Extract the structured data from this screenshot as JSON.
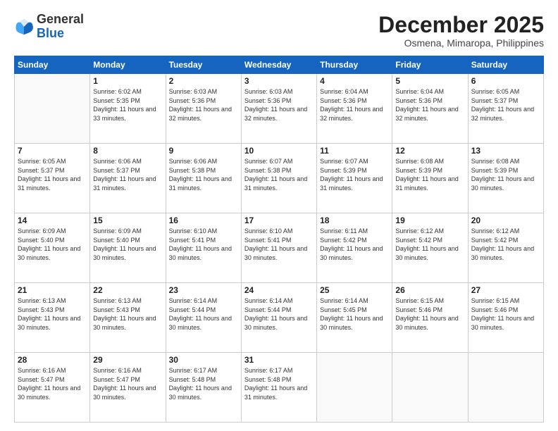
{
  "header": {
    "logo_general": "General",
    "logo_blue": "Blue",
    "title": "December 2025",
    "subtitle": "Osmena, Mimaropa, Philippines"
  },
  "calendar": {
    "days_of_week": [
      "Sunday",
      "Monday",
      "Tuesday",
      "Wednesday",
      "Thursday",
      "Friday",
      "Saturday"
    ],
    "weeks": [
      [
        {
          "day": "",
          "empty": true
        },
        {
          "day": "1",
          "sunrise": "6:02 AM",
          "sunset": "5:35 PM",
          "daylight": "11 hours and 33 minutes."
        },
        {
          "day": "2",
          "sunrise": "6:03 AM",
          "sunset": "5:36 PM",
          "daylight": "11 hours and 32 minutes."
        },
        {
          "day": "3",
          "sunrise": "6:03 AM",
          "sunset": "5:36 PM",
          "daylight": "11 hours and 32 minutes."
        },
        {
          "day": "4",
          "sunrise": "6:04 AM",
          "sunset": "5:36 PM",
          "daylight": "11 hours and 32 minutes."
        },
        {
          "day": "5",
          "sunrise": "6:04 AM",
          "sunset": "5:36 PM",
          "daylight": "11 hours and 32 minutes."
        },
        {
          "day": "6",
          "sunrise": "6:05 AM",
          "sunset": "5:37 PM",
          "daylight": "11 hours and 32 minutes."
        }
      ],
      [
        {
          "day": "7",
          "sunrise": "6:05 AM",
          "sunset": "5:37 PM",
          "daylight": "11 hours and 31 minutes."
        },
        {
          "day": "8",
          "sunrise": "6:06 AM",
          "sunset": "5:37 PM",
          "daylight": "11 hours and 31 minutes."
        },
        {
          "day": "9",
          "sunrise": "6:06 AM",
          "sunset": "5:38 PM",
          "daylight": "11 hours and 31 minutes."
        },
        {
          "day": "10",
          "sunrise": "6:07 AM",
          "sunset": "5:38 PM",
          "daylight": "11 hours and 31 minutes."
        },
        {
          "day": "11",
          "sunrise": "6:07 AM",
          "sunset": "5:39 PM",
          "daylight": "11 hours and 31 minutes."
        },
        {
          "day": "12",
          "sunrise": "6:08 AM",
          "sunset": "5:39 PM",
          "daylight": "11 hours and 31 minutes."
        },
        {
          "day": "13",
          "sunrise": "6:08 AM",
          "sunset": "5:39 PM",
          "daylight": "11 hours and 30 minutes."
        }
      ],
      [
        {
          "day": "14",
          "sunrise": "6:09 AM",
          "sunset": "5:40 PM",
          "daylight": "11 hours and 30 minutes."
        },
        {
          "day": "15",
          "sunrise": "6:09 AM",
          "sunset": "5:40 PM",
          "daylight": "11 hours and 30 minutes."
        },
        {
          "day": "16",
          "sunrise": "6:10 AM",
          "sunset": "5:41 PM",
          "daylight": "11 hours and 30 minutes."
        },
        {
          "day": "17",
          "sunrise": "6:10 AM",
          "sunset": "5:41 PM",
          "daylight": "11 hours and 30 minutes."
        },
        {
          "day": "18",
          "sunrise": "6:11 AM",
          "sunset": "5:42 PM",
          "daylight": "11 hours and 30 minutes."
        },
        {
          "day": "19",
          "sunrise": "6:12 AM",
          "sunset": "5:42 PM",
          "daylight": "11 hours and 30 minutes."
        },
        {
          "day": "20",
          "sunrise": "6:12 AM",
          "sunset": "5:42 PM",
          "daylight": "11 hours and 30 minutes."
        }
      ],
      [
        {
          "day": "21",
          "sunrise": "6:13 AM",
          "sunset": "5:43 PM",
          "daylight": "11 hours and 30 minutes."
        },
        {
          "day": "22",
          "sunrise": "6:13 AM",
          "sunset": "5:43 PM",
          "daylight": "11 hours and 30 minutes."
        },
        {
          "day": "23",
          "sunrise": "6:14 AM",
          "sunset": "5:44 PM",
          "daylight": "11 hours and 30 minutes."
        },
        {
          "day": "24",
          "sunrise": "6:14 AM",
          "sunset": "5:44 PM",
          "daylight": "11 hours and 30 minutes."
        },
        {
          "day": "25",
          "sunrise": "6:14 AM",
          "sunset": "5:45 PM",
          "daylight": "11 hours and 30 minutes."
        },
        {
          "day": "26",
          "sunrise": "6:15 AM",
          "sunset": "5:46 PM",
          "daylight": "11 hours and 30 minutes."
        },
        {
          "day": "27",
          "sunrise": "6:15 AM",
          "sunset": "5:46 PM",
          "daylight": "11 hours and 30 minutes."
        }
      ],
      [
        {
          "day": "28",
          "sunrise": "6:16 AM",
          "sunset": "5:47 PM",
          "daylight": "11 hours and 30 minutes."
        },
        {
          "day": "29",
          "sunrise": "6:16 AM",
          "sunset": "5:47 PM",
          "daylight": "11 hours and 30 minutes."
        },
        {
          "day": "30",
          "sunrise": "6:17 AM",
          "sunset": "5:48 PM",
          "daylight": "11 hours and 30 minutes."
        },
        {
          "day": "31",
          "sunrise": "6:17 AM",
          "sunset": "5:48 PM",
          "daylight": "11 hours and 31 minutes."
        },
        {
          "day": "",
          "empty": true
        },
        {
          "day": "",
          "empty": true
        },
        {
          "day": "",
          "empty": true
        }
      ]
    ]
  }
}
